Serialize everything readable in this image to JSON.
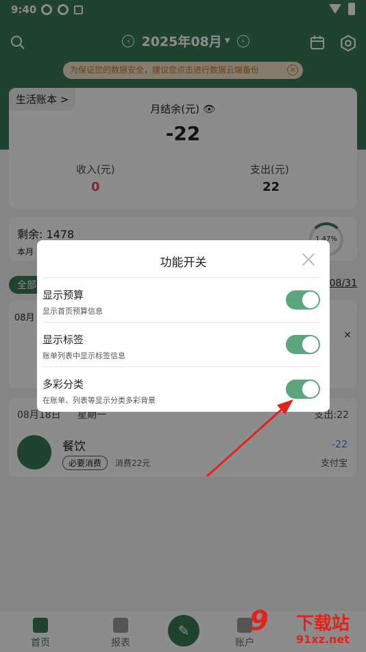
{
  "status_bar": {
    "time": "9:40"
  },
  "topbar": {
    "month": "2025年08月"
  },
  "notice": {
    "text": "为保证您的数据安全，建议您点击进行数据云端备份",
    "close": "×"
  },
  "main_card": {
    "book": "生活账本 >",
    "balance_label": "月结余(元)",
    "balance_value": "-22",
    "income_label": "收入(元)",
    "income_value": "0",
    "expense_label": "支出(元)",
    "expense_value": "22"
  },
  "budget": {
    "remain": "剩余: 1478",
    "sub": "本月",
    "percent": "1.47%"
  },
  "filter": {
    "all": "全部",
    "date": "08/31"
  },
  "ad": {
    "date": "08月",
    "close": "×"
  },
  "bill": {
    "date": "08月18日",
    "weekday": "星期一",
    "sum": "支出:22",
    "name": "餐饮",
    "tag": "必要消费",
    "note": "消费22元",
    "amount": "-22",
    "method": "支付宝"
  },
  "dialog": {
    "title": "功能开关",
    "options": [
      {
        "title": "显示预算",
        "desc": "显示首页预算信息",
        "on": true
      },
      {
        "title": "显示标签",
        "desc": "账单列表中显示标签信息",
        "on": true
      },
      {
        "title": "多彩分类",
        "desc": "在账单、列表等显示分类多彩背景",
        "on": true
      }
    ]
  },
  "bottom_nav": {
    "home": "首页",
    "report": "报表",
    "account": "账户"
  },
  "watermark": {
    "num": "9",
    "text": "下载站",
    "url": "91xz.net"
  },
  "colors": {
    "brand": "#3b7b56",
    "toggle_on": "#5da57c",
    "arrow": "#e2231a"
  }
}
